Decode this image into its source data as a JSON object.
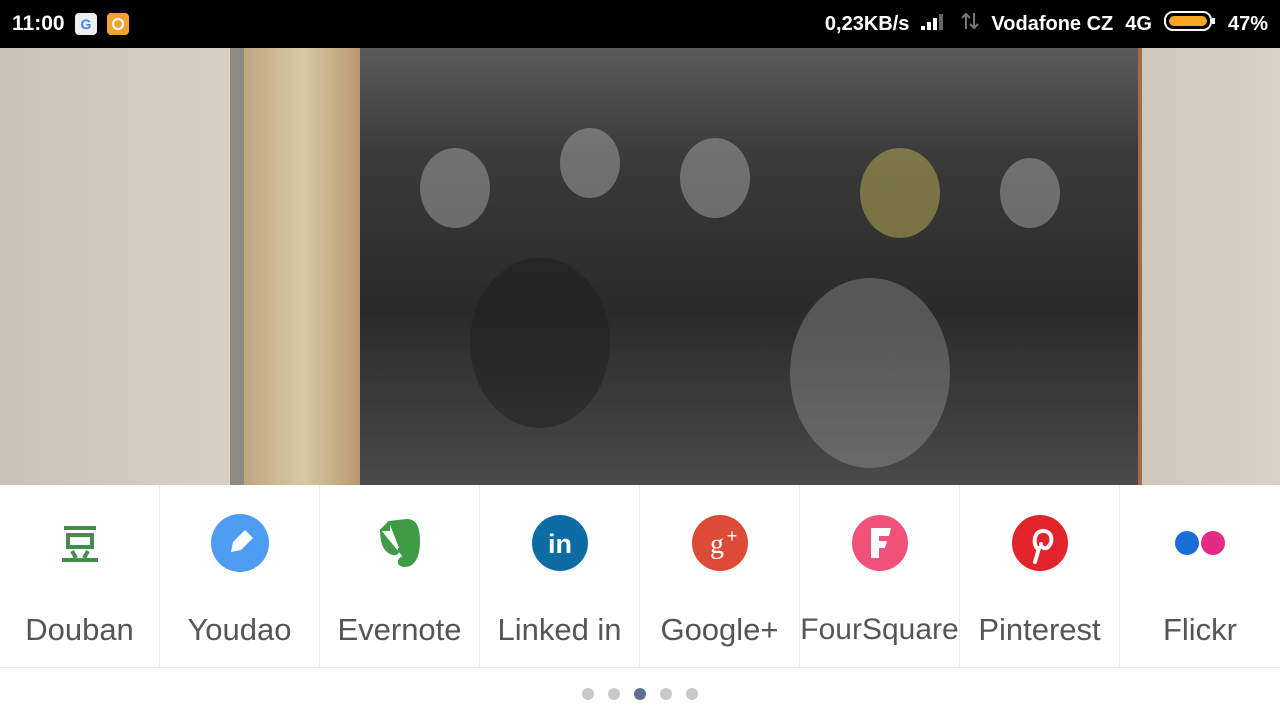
{
  "status_bar": {
    "time": "11:00",
    "net_speed": "0,23KB/s",
    "carrier": "Vodafone CZ",
    "network": "4G",
    "battery": "47%",
    "icons": [
      "google-icon",
      "message-app-icon",
      "signal-icon",
      "data-arrows-icon",
      "battery-icon"
    ]
  },
  "share": {
    "items": [
      {
        "label": "Douban",
        "icon": "douban-icon",
        "color": "#3f8f4a"
      },
      {
        "label": "Youdao",
        "icon": "youdao-icon",
        "color": "#4d9df0"
      },
      {
        "label": "Evernote",
        "icon": "evernote-icon",
        "color": "#3f9b45"
      },
      {
        "label": "Linked in",
        "icon": "linkedin-icon",
        "color": "#0e6ca5"
      },
      {
        "label": "Google+",
        "icon": "google-plus-icon",
        "color": "#dd4a38"
      },
      {
        "label": "FourSquare",
        "icon": "foursquare-icon",
        "color": "#f1527a"
      },
      {
        "label": "Pinterest",
        "icon": "pinterest-icon",
        "color": "#e1232b"
      },
      {
        "label": "Flickr",
        "icon": "flickr-icon",
        "colors": [
          "#1a6fd6",
          "#e52a85"
        ]
      }
    ],
    "pager": {
      "count": 5,
      "active": 3
    }
  }
}
